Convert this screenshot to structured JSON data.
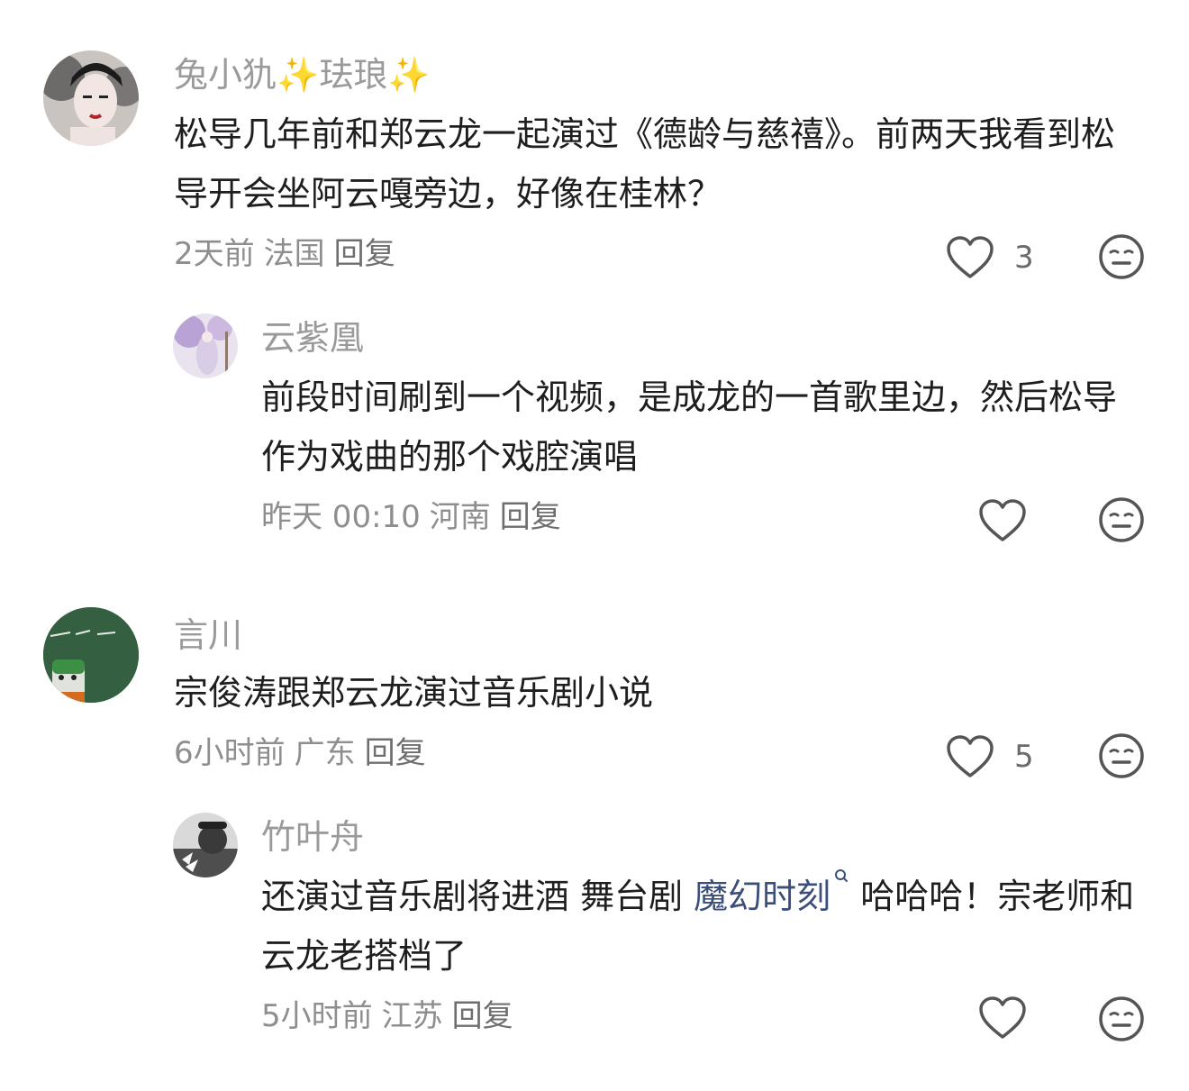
{
  "comments": [
    {
      "username": "兔小犰",
      "username_sparkle_1": "✨",
      "username_mid": "珐琅",
      "username_sparkle_2": "✨",
      "text": "松导几年前和郑云龙一起演过《德龄与慈禧》。前两天我看到松导开会坐阿云嘎旁边，好像在桂林？",
      "time": "2天前",
      "location": "法国",
      "reply": "回复",
      "likes": "3",
      "replies": [
        {
          "username": "云紫凰",
          "text": "前段时间刷到一个视频，是成龙的一首歌里边，然后松导作为戏曲的那个戏腔演唱",
          "time": "昨天 00:10",
          "location": "河南",
          "reply": "回复",
          "likes": ""
        }
      ]
    },
    {
      "username": "言川",
      "text": "宗俊涛跟郑云龙演过音乐剧小说",
      "time": "6小时前",
      "location": "广东",
      "reply": "回复",
      "likes": "5",
      "replies": [
        {
          "username": "竹叶舟",
          "text_before_link": "还演过音乐剧将进酒 舞台剧 ",
          "link_text": "魔幻时刻",
          "text_after_link": " 哈哈哈！宗老师和云龙老搭档了",
          "time": "5小时前",
          "location": "江苏",
          "reply": "回复",
          "likes": ""
        }
      ]
    }
  ],
  "icons": {
    "like": "heart-outline-icon",
    "dislike": "neutral-face-icon",
    "search": "search-icon"
  },
  "colors": {
    "username": "#9a9a9a",
    "text": "#1e1e1e",
    "meta": "#8e8e8e",
    "link": "#3b4f7a",
    "icon": "#555555"
  }
}
